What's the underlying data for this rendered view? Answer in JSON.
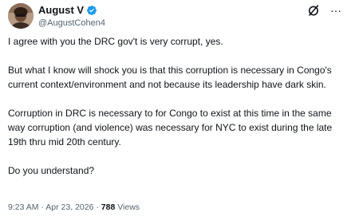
{
  "author": {
    "display_name": "August V",
    "handle": "@AugustCohen4",
    "verified": true,
    "verified_color": "#1d9bf0"
  },
  "header_icons": [
    "grok-slash-icon",
    "more-icon"
  ],
  "more_glyph": "···",
  "tweet": {
    "paragraphs": [
      "I agree with you the DRC gov't is very corrupt, yes.",
      "But what I know will shock you is that this corruption is necessary in Congo's current context/environment and not because its leadership have dark skin.",
      "Corruption in DRC is necessary to for Congo to exist at this time in the same way corruption (and violence) was necessary for NYC to exist during the late 19th thru mid 20th century.",
      "Do you understand?"
    ]
  },
  "meta": {
    "time": "9:23 AM",
    "separator": "·",
    "date": "Apr 23, 2026",
    "views_count": "788",
    "views_label": "Views"
  },
  "colors": {
    "text_primary": "#0f1419",
    "text_secondary": "#536471",
    "background": "#ffffff"
  }
}
